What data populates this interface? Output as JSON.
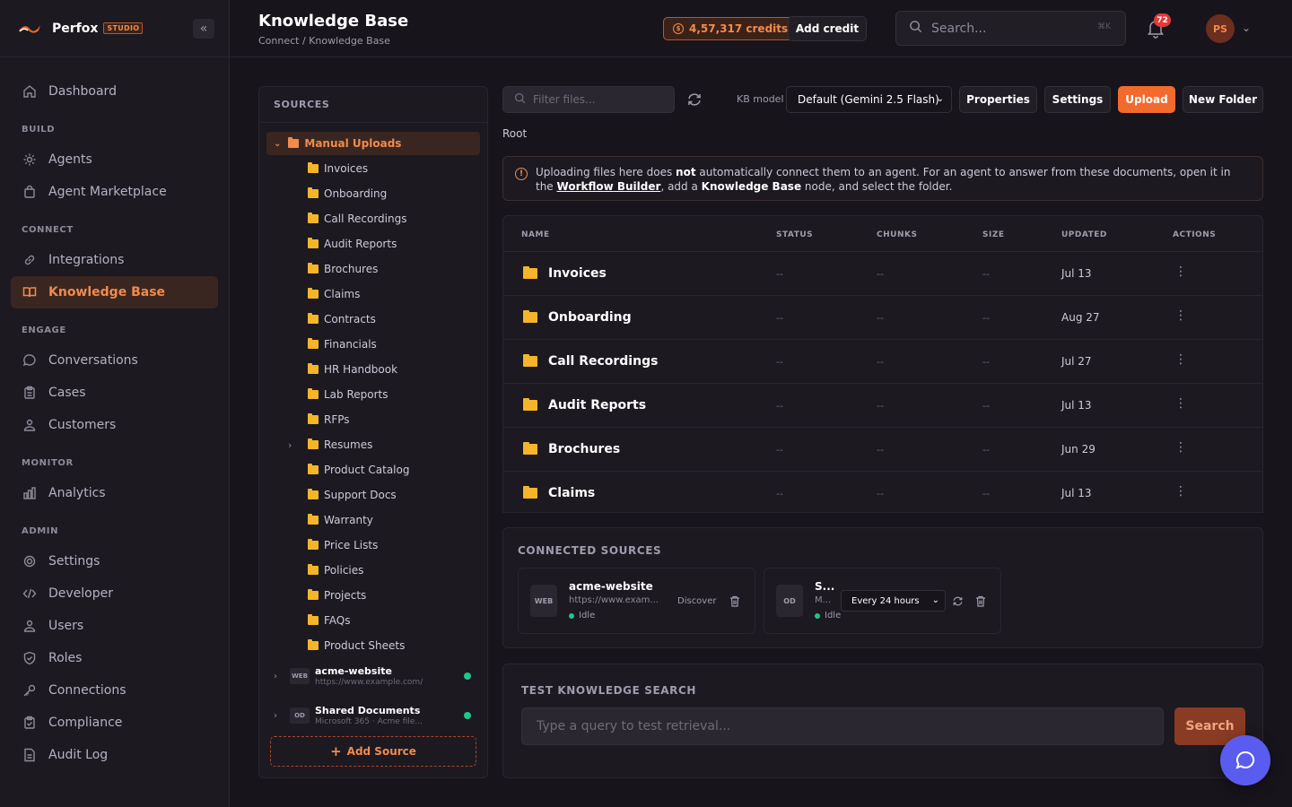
{
  "brand": {
    "name": "Perfox",
    "studio": "STUDIO"
  },
  "nav": {
    "dashboard": "Dashboard",
    "sections": {
      "build": "BUILD",
      "connect": "CONNECT",
      "engage": "ENGAGE",
      "monitor": "MONITOR",
      "admin": "ADMIN"
    },
    "build": [
      "Agents",
      "Agent Marketplace"
    ],
    "connect": [
      "Integrations",
      "Knowledge Base"
    ],
    "engage": [
      "Conversations",
      "Cases",
      "Customers"
    ],
    "monitor": [
      "Analytics"
    ],
    "admin": [
      "Settings",
      "Developer",
      "Users",
      "Roles",
      "Connections",
      "Compliance",
      "Audit Log"
    ]
  },
  "header": {
    "title": "Knowledge Base",
    "breadcrumb": "Connect / Knowledge Base",
    "credits": "4,57,317 credits",
    "add_credit": "Add credit",
    "search_placeholder": "Search...",
    "search_shortcut": "⌘K",
    "notifications": "72",
    "avatar": "PS"
  },
  "sources": {
    "heading": "SOURCES",
    "root": "Manual Uploads",
    "folders": [
      "Invoices",
      "Onboarding",
      "Call Recordings",
      "Audit Reports",
      "Brochures",
      "Claims",
      "Contracts",
      "Financials",
      "HR Handbook",
      "Lab Reports",
      "RFPs",
      "Resumes",
      "Product Catalog",
      "Support Docs",
      "Warranty",
      "Price Lists",
      "Policies",
      "Projects",
      "FAQs",
      "Product Sheets"
    ],
    "connected": [
      {
        "tag": "WEB",
        "name": "acme-website",
        "url": "https://www.example.com/"
      },
      {
        "tag": "OD",
        "name": "Shared Documents",
        "url": "Microsoft 365 · Acme file..."
      }
    ],
    "add_source": "Add Source"
  },
  "toolbar": {
    "filter_placeholder": "Filter files...",
    "kb_model_label": "KB model",
    "kb_model_value": "Default (Gemini 2.5 Flash)",
    "properties": "Properties",
    "settings": "Settings",
    "upload": "Upload",
    "new_folder": "New Folder"
  },
  "root_label": "Root",
  "notice": {
    "p1": "Uploading files here does ",
    "not": "not",
    "p2": " automatically connect them to an agent. For an agent to answer from these documents, open it in the ",
    "link": "Workflow Builder",
    "p3": ", add a ",
    "kb": "Knowledge Base",
    "p4": " node, and select the folder."
  },
  "table": {
    "columns": [
      "NAME",
      "STATUS",
      "CHUNKS",
      "SIZE",
      "UPDATED",
      "ACTIONS"
    ],
    "rows": [
      {
        "name": "Invoices",
        "status": "--",
        "chunks": "--",
        "size": "--",
        "updated": "Jul 13"
      },
      {
        "name": "Onboarding",
        "status": "--",
        "chunks": "--",
        "size": "--",
        "updated": "Aug 27"
      },
      {
        "name": "Call Recordings",
        "status": "--",
        "chunks": "--",
        "size": "--",
        "updated": "Jul 27"
      },
      {
        "name": "Audit Reports",
        "status": "--",
        "chunks": "--",
        "size": "--",
        "updated": "Jul 13"
      },
      {
        "name": "Brochures",
        "status": "--",
        "chunks": "--",
        "size": "--",
        "updated": "Jun 29"
      },
      {
        "name": "Claims",
        "status": "--",
        "chunks": "--",
        "size": "--",
        "updated": "Jul 13"
      }
    ]
  },
  "connected": {
    "title": "CONNECTED SOURCES",
    "cards": [
      {
        "tag": "WEB",
        "name": "acme-website",
        "url": "https://www.exam...",
        "status": "Idle",
        "action": "Discover"
      },
      {
        "tag": "OD",
        "name": "S...",
        "url": "M...",
        "status": "Idle",
        "schedule": "Every 24 hours"
      }
    ]
  },
  "test": {
    "title": "TEST KNOWLEDGE SEARCH",
    "placeholder": "Type a query to test retrieval...",
    "button": "Search"
  },
  "colors": {
    "accent": "#f26a2e",
    "accent_text": "#f28b4b",
    "folder": "#f5b529",
    "status_ok": "#22c58b",
    "chat": "#5a5cf0"
  }
}
